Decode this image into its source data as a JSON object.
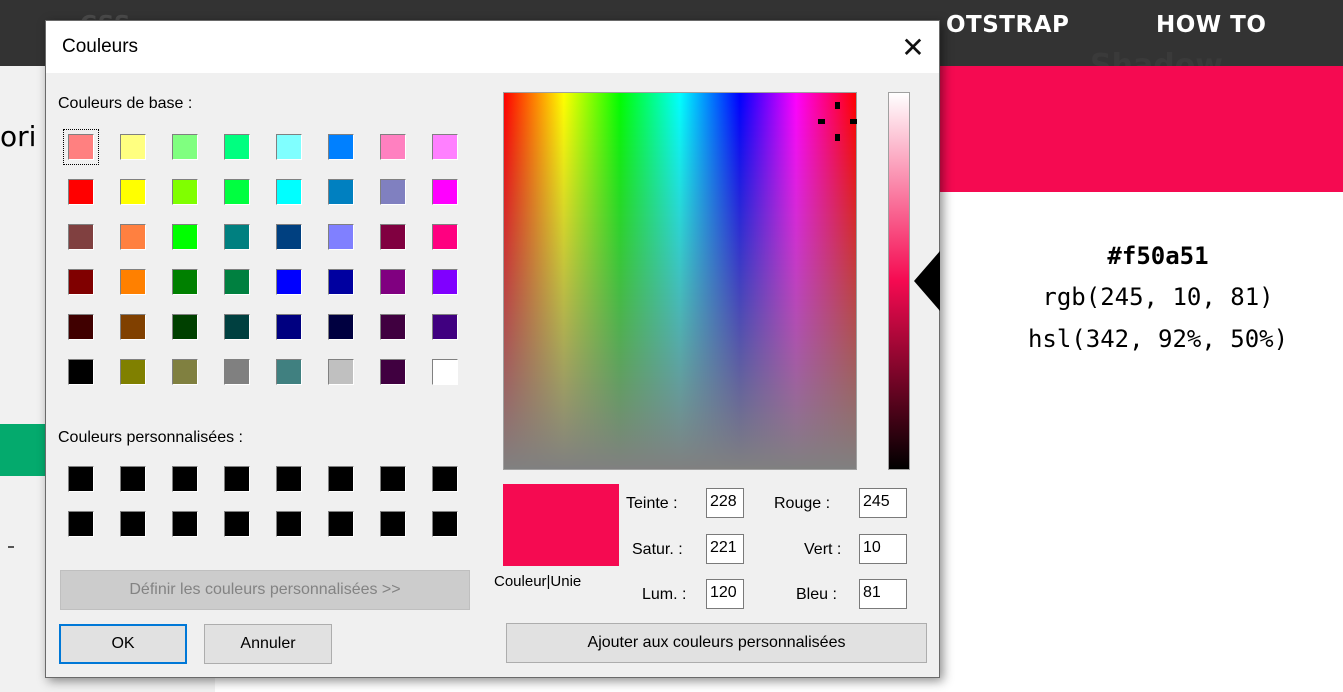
{
  "background_page": {
    "nav_items": [
      "OTSTRAP",
      "HOW TO"
    ],
    "side_text": "ori",
    "hero_text": "Shadow",
    "color_hex": "#f50a51",
    "color_rgb": "rgb(245, 10, 81)",
    "color_hsl": "hsl(342, 92%, 50%)"
  },
  "dialog": {
    "title": "Couleurs",
    "close_icon": "close-icon",
    "basic_colors_label": "Couleurs de base :",
    "basic_colors": [
      [
        "#ff8080",
        "#ffff80",
        "#80ff80",
        "#00ff80",
        "#80ffff",
        "#0080ff",
        "#ff80c0",
        "#ff80ff"
      ],
      [
        "#ff0000",
        "#ffff00",
        "#80ff00",
        "#00ff40",
        "#00ffff",
        "#0080c0",
        "#8080c0",
        "#ff00ff"
      ],
      [
        "#804040",
        "#ff8040",
        "#00ff00",
        "#008080",
        "#004080",
        "#8080ff",
        "#800040",
        "#ff0080"
      ],
      [
        "#800000",
        "#ff8000",
        "#008000",
        "#008040",
        "#0000ff",
        "#0000a0",
        "#800080",
        "#8000ff"
      ],
      [
        "#400000",
        "#804000",
        "#004000",
        "#004040",
        "#000080",
        "#000040",
        "#400040",
        "#400080"
      ],
      [
        "#000000",
        "#808000",
        "#808040",
        "#808080",
        "#408080",
        "#c0c0c0",
        "#400040",
        "#ffffff"
      ]
    ],
    "custom_colors_label": "Couleurs personnalisées :",
    "custom_colors": [
      [
        "#000000",
        "#000000",
        "#000000",
        "#000000",
        "#000000",
        "#000000",
        "#000000",
        "#000000"
      ],
      [
        "#000000",
        "#000000",
        "#000000",
        "#000000",
        "#000000",
        "#000000",
        "#000000",
        "#000000"
      ]
    ],
    "define_custom_button": "Définir les couleurs personnalisées >>",
    "ok_button": "OK",
    "cancel_button": "Annuler",
    "add_custom_button": "Ajouter aux couleurs personnalisées",
    "preview_label": "Couleur|Unie",
    "preview_color": "#f50a51",
    "fields": {
      "hue_label": "Teinte :",
      "hue_value": "228",
      "sat_label": "Satur. :",
      "sat_value": "221",
      "lum_label": "Lum. :",
      "lum_value": "120",
      "red_label": "Rouge :",
      "red_value": "245",
      "green_label": "Vert :",
      "green_value": "10",
      "blue_label": "Bleu :",
      "blue_value": "81"
    }
  }
}
